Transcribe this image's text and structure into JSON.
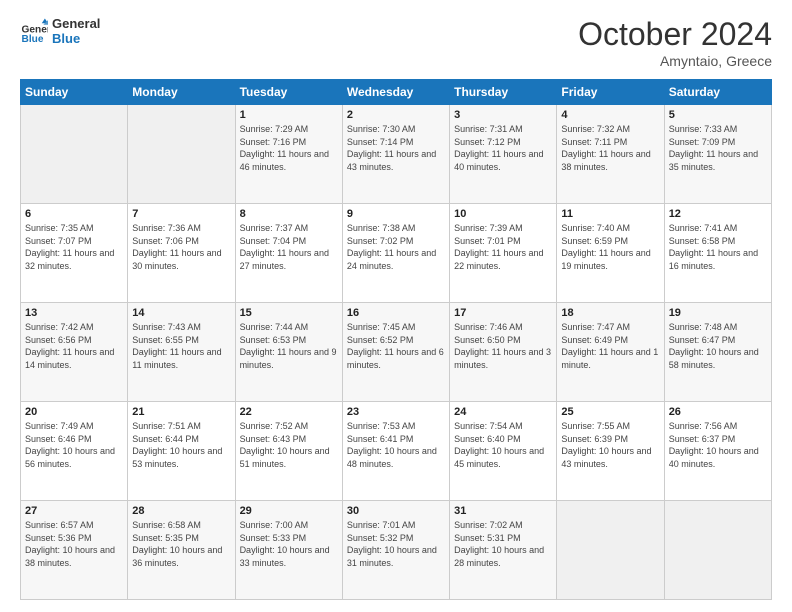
{
  "logo": {
    "line1": "General",
    "line2": "Blue"
  },
  "title": "October 2024",
  "location": "Amyntaio, Greece",
  "days_header": [
    "Sunday",
    "Monday",
    "Tuesday",
    "Wednesday",
    "Thursday",
    "Friday",
    "Saturday"
  ],
  "weeks": [
    [
      null,
      null,
      {
        "day": "1",
        "sunrise": "7:29 AM",
        "sunset": "7:16 PM",
        "daylight": "11 hours and 46 minutes."
      },
      {
        "day": "2",
        "sunrise": "7:30 AM",
        "sunset": "7:14 PM",
        "daylight": "11 hours and 43 minutes."
      },
      {
        "day": "3",
        "sunrise": "7:31 AM",
        "sunset": "7:12 PM",
        "daylight": "11 hours and 40 minutes."
      },
      {
        "day": "4",
        "sunrise": "7:32 AM",
        "sunset": "7:11 PM",
        "daylight": "11 hours and 38 minutes."
      },
      {
        "day": "5",
        "sunrise": "7:33 AM",
        "sunset": "7:09 PM",
        "daylight": "11 hours and 35 minutes."
      }
    ],
    [
      {
        "day": "6",
        "sunrise": "7:35 AM",
        "sunset": "7:07 PM",
        "daylight": "11 hours and 32 minutes."
      },
      {
        "day": "7",
        "sunrise": "7:36 AM",
        "sunset": "7:06 PM",
        "daylight": "11 hours and 30 minutes."
      },
      {
        "day": "8",
        "sunrise": "7:37 AM",
        "sunset": "7:04 PM",
        "daylight": "11 hours and 27 minutes."
      },
      {
        "day": "9",
        "sunrise": "7:38 AM",
        "sunset": "7:02 PM",
        "daylight": "11 hours and 24 minutes."
      },
      {
        "day": "10",
        "sunrise": "7:39 AM",
        "sunset": "7:01 PM",
        "daylight": "11 hours and 22 minutes."
      },
      {
        "day": "11",
        "sunrise": "7:40 AM",
        "sunset": "6:59 PM",
        "daylight": "11 hours and 19 minutes."
      },
      {
        "day": "12",
        "sunrise": "7:41 AM",
        "sunset": "6:58 PM",
        "daylight": "11 hours and 16 minutes."
      }
    ],
    [
      {
        "day": "13",
        "sunrise": "7:42 AM",
        "sunset": "6:56 PM",
        "daylight": "11 hours and 14 minutes."
      },
      {
        "day": "14",
        "sunrise": "7:43 AM",
        "sunset": "6:55 PM",
        "daylight": "11 hours and 11 minutes."
      },
      {
        "day": "15",
        "sunrise": "7:44 AM",
        "sunset": "6:53 PM",
        "daylight": "11 hours and 9 minutes."
      },
      {
        "day": "16",
        "sunrise": "7:45 AM",
        "sunset": "6:52 PM",
        "daylight": "11 hours and 6 minutes."
      },
      {
        "day": "17",
        "sunrise": "7:46 AM",
        "sunset": "6:50 PM",
        "daylight": "11 hours and 3 minutes."
      },
      {
        "day": "18",
        "sunrise": "7:47 AM",
        "sunset": "6:49 PM",
        "daylight": "11 hours and 1 minute."
      },
      {
        "day": "19",
        "sunrise": "7:48 AM",
        "sunset": "6:47 PM",
        "daylight": "10 hours and 58 minutes."
      }
    ],
    [
      {
        "day": "20",
        "sunrise": "7:49 AM",
        "sunset": "6:46 PM",
        "daylight": "10 hours and 56 minutes."
      },
      {
        "day": "21",
        "sunrise": "7:51 AM",
        "sunset": "6:44 PM",
        "daylight": "10 hours and 53 minutes."
      },
      {
        "day": "22",
        "sunrise": "7:52 AM",
        "sunset": "6:43 PM",
        "daylight": "10 hours and 51 minutes."
      },
      {
        "day": "23",
        "sunrise": "7:53 AM",
        "sunset": "6:41 PM",
        "daylight": "10 hours and 48 minutes."
      },
      {
        "day": "24",
        "sunrise": "7:54 AM",
        "sunset": "6:40 PM",
        "daylight": "10 hours and 45 minutes."
      },
      {
        "day": "25",
        "sunrise": "7:55 AM",
        "sunset": "6:39 PM",
        "daylight": "10 hours and 43 minutes."
      },
      {
        "day": "26",
        "sunrise": "7:56 AM",
        "sunset": "6:37 PM",
        "daylight": "10 hours and 40 minutes."
      }
    ],
    [
      {
        "day": "27",
        "sunrise": "6:57 AM",
        "sunset": "5:36 PM",
        "daylight": "10 hours and 38 minutes."
      },
      {
        "day": "28",
        "sunrise": "6:58 AM",
        "sunset": "5:35 PM",
        "daylight": "10 hours and 36 minutes."
      },
      {
        "day": "29",
        "sunrise": "7:00 AM",
        "sunset": "5:33 PM",
        "daylight": "10 hours and 33 minutes."
      },
      {
        "day": "30",
        "sunrise": "7:01 AM",
        "sunset": "5:32 PM",
        "daylight": "10 hours and 31 minutes."
      },
      {
        "day": "31",
        "sunrise": "7:02 AM",
        "sunset": "5:31 PM",
        "daylight": "10 hours and 28 minutes."
      },
      null,
      null
    ]
  ]
}
